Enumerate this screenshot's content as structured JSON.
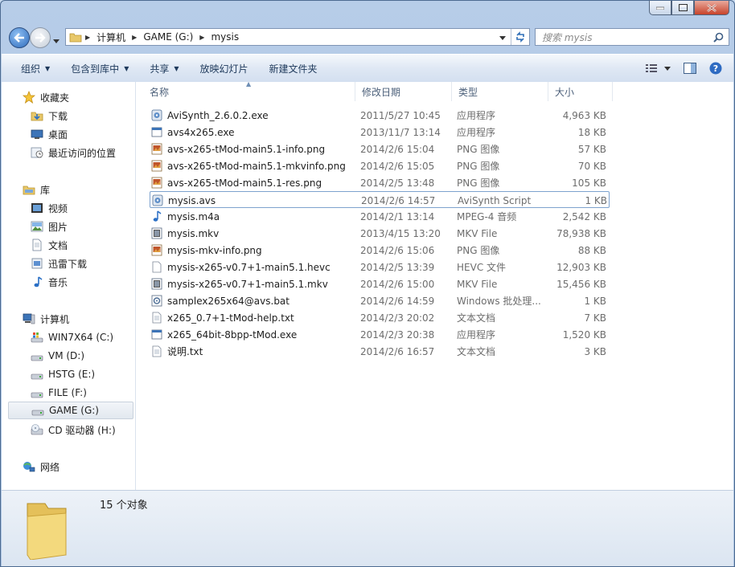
{
  "address": {
    "crumbs": [
      "计算机",
      "GAME (G:)",
      "mysis"
    ],
    "search_placeholder": "搜索 mysis"
  },
  "toolbar": {
    "items": [
      {
        "label": "组织",
        "dropdown": true
      },
      {
        "label": "包含到库中",
        "dropdown": true
      },
      {
        "label": "共享",
        "dropdown": true
      },
      {
        "label": "放映幻灯片",
        "dropdown": false
      },
      {
        "label": "新建文件夹",
        "dropdown": false
      }
    ]
  },
  "nav": {
    "favorites": {
      "title": "收藏夹",
      "items": [
        "下载",
        "桌面",
        "最近访问的位置"
      ]
    },
    "libraries": {
      "title": "库",
      "items": [
        "视频",
        "图片",
        "文档",
        "迅雷下载",
        "音乐"
      ]
    },
    "computer": {
      "title": "计算机",
      "items": [
        "WIN7X64 (C:)",
        "VM (D:)",
        "HSTG (E:)",
        "FILE (F:)",
        "GAME (G:)",
        "CD 驱动器 (H:)"
      ]
    },
    "network": {
      "title": "网络"
    }
  },
  "columns": [
    "名称",
    "修改日期",
    "类型",
    "大小"
  ],
  "files": [
    {
      "name": "AviSynth_2.6.0.2.exe",
      "date": "2011/5/27 10:45",
      "type": "应用程序",
      "size": "4,963 KB",
      "icon": "installer-icon"
    },
    {
      "name": "avs4x265.exe",
      "date": "2013/11/7 13:14",
      "type": "应用程序",
      "size": "18 KB",
      "icon": "exe-icon"
    },
    {
      "name": "avs-x265-tMod-main5.1-info.png",
      "date": "2014/2/6 15:04",
      "type": "PNG 图像",
      "size": "57 KB",
      "icon": "png-icon"
    },
    {
      "name": "avs-x265-tMod-main5.1-mkvinfo.png",
      "date": "2014/2/6 15:05",
      "type": "PNG 图像",
      "size": "70 KB",
      "icon": "png-icon"
    },
    {
      "name": "avs-x265-tMod-main5.1-res.png",
      "date": "2014/2/5 13:48",
      "type": "PNG 图像",
      "size": "105 KB",
      "icon": "png-icon"
    },
    {
      "name": "mysis.avs",
      "date": "2014/2/6 14:57",
      "type": "AviSynth Script",
      "size": "1 KB",
      "icon": "avs-script-icon"
    },
    {
      "name": "mysis.m4a",
      "date": "2014/2/1 13:14",
      "type": "MPEG-4 音频",
      "size": "2,542 KB",
      "icon": "audio-icon"
    },
    {
      "name": "mysis.mkv",
      "date": "2013/4/15 13:20",
      "type": "MKV File",
      "size": "78,938 KB",
      "icon": "video-icon"
    },
    {
      "name": "mysis-mkv-info.png",
      "date": "2014/2/6 15:06",
      "type": "PNG 图像",
      "size": "88 KB",
      "icon": "png-icon"
    },
    {
      "name": "mysis-x265-v0.7+1-main5.1.hevc",
      "date": "2014/2/5 13:39",
      "type": "HEVC 文件",
      "size": "12,903 KB",
      "icon": "blank-file-icon"
    },
    {
      "name": "mysis-x265-v0.7+1-main5.1.mkv",
      "date": "2014/2/6 15:00",
      "type": "MKV File",
      "size": "15,456 KB",
      "icon": "video-icon"
    },
    {
      "name": "samplex265x64@avs.bat",
      "date": "2014/2/6 14:59",
      "type": "Windows 批处理...",
      "size": "1 KB",
      "icon": "bat-icon"
    },
    {
      "name": "x265_0.7+1-tMod-help.txt",
      "date": "2014/2/3 20:02",
      "type": "文本文档",
      "size": "7 KB",
      "icon": "text-file-icon"
    },
    {
      "name": "x265_64bit-8bpp-tMod.exe",
      "date": "2014/2/3 20:38",
      "type": "应用程序",
      "size": "1,520 KB",
      "icon": "exe-icon"
    },
    {
      "name": "说明.txt",
      "date": "2014/2/6 16:57",
      "type": "文本文档",
      "size": "3 KB",
      "icon": "text-file-icon"
    }
  ],
  "status": {
    "count": "15 个对象"
  },
  "colors": {
    "accent": "#3d7ab8",
    "selection_border": "#7da2ce",
    "toolbar_text": "#1e395b"
  }
}
